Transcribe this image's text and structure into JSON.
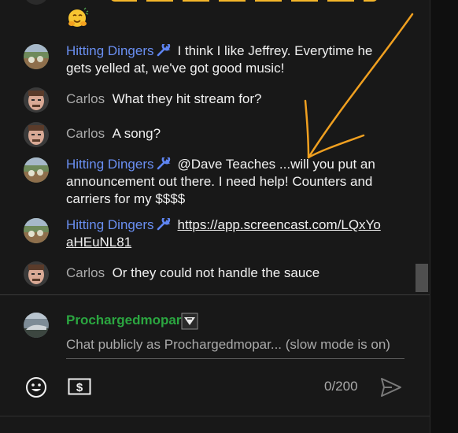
{
  "messages": [
    {
      "author": "Hitting Dingers",
      "member": true,
      "text": "I think I like Jeffrey. Everytime he gets yelled at, we've got good music!"
    },
    {
      "author": "Carlos",
      "member": false,
      "text": "What they hit stream for?"
    },
    {
      "author": "Carlos",
      "member": false,
      "text": "A song?"
    },
    {
      "author": "Hitting Dingers",
      "member": true,
      "text": "@Dave Teaches ...will you put an announcement out there. I need help! Counters and carriers for my $$$$"
    },
    {
      "author": "Hitting Dingers",
      "member": true,
      "link": "https://app.screencast.com/LQxYoaHEuNL81"
    },
    {
      "author": "Carlos",
      "member": false,
      "text": "Or they could not handle the sauce"
    }
  ],
  "composer": {
    "username": "Prochargedmopar",
    "placeholder": "Chat publicly as Prochargedmopar... (slow mode is on)",
    "counter": "0/200"
  },
  "icons": {
    "member_badge": "wrench-icon",
    "emoji": "emoji-icon",
    "super_chat": "dollar-icon",
    "send": "send-icon",
    "top_emoji": "hugging-face-icon"
  },
  "colors": {
    "background": "#181818",
    "member_name": "#6a8ff2",
    "author_name": "#aaaaaa",
    "username": "#2ba640",
    "annotation": "#f0a020"
  }
}
